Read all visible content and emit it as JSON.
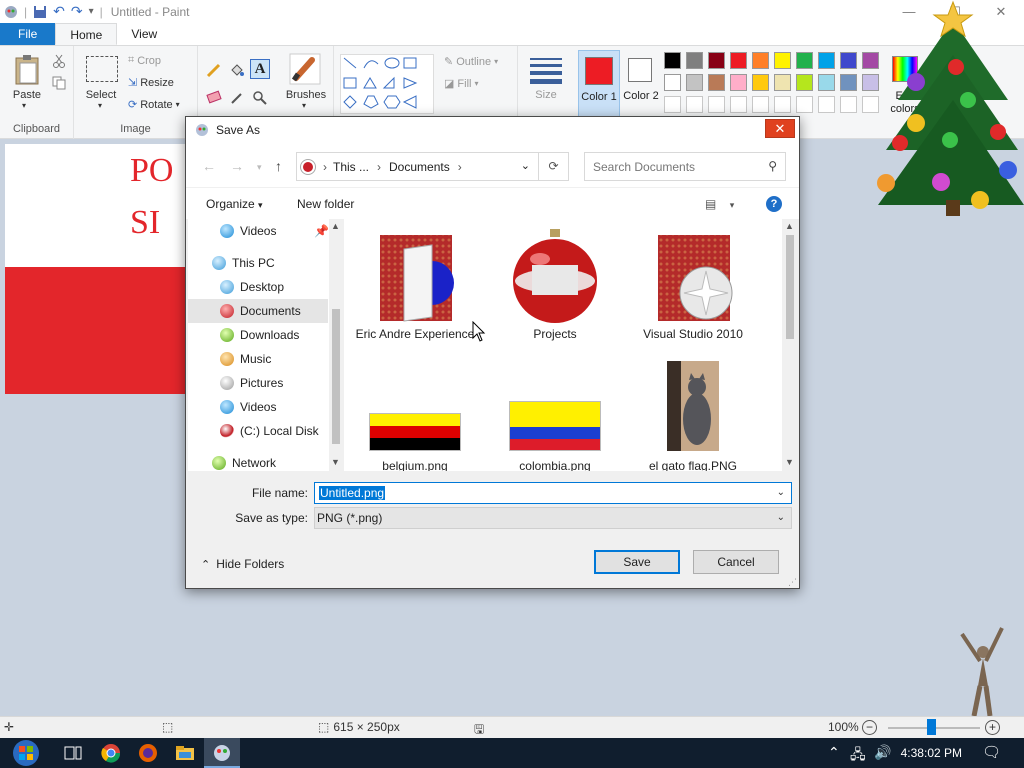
{
  "paint": {
    "title": "Untitled - Paint",
    "tabs": [
      "File",
      "Home",
      "View"
    ],
    "ribbon": {
      "clipboard": {
        "label": "Clipboard",
        "paste": "Paste"
      },
      "image": {
        "label": "Image",
        "select": "Select",
        "crop": "Crop",
        "resize": "Resize",
        "rotate": "Rotate"
      },
      "tools": {
        "brushes": "Brushes"
      },
      "shapes": {
        "outline": "Outline",
        "fill": "Fill"
      },
      "size": "Size",
      "color1": "Color 1",
      "color2": "Color 2",
      "edit_colors": "Edit colors"
    },
    "palette_row1": [
      "#000000",
      "#7f7f7f",
      "#880015",
      "#ed1c24",
      "#ff7f27",
      "#fff200",
      "#22b14c",
      "#00a2e8",
      "#3f48cc",
      "#a349a4"
    ],
    "palette_row2": [
      "#ffffff",
      "#c3c3c3",
      "#b97a57",
      "#ffaec9",
      "#ffc90e",
      "#efe4b0",
      "#b5e61d",
      "#99d9ea",
      "#7092be",
      "#c8bfe7"
    ],
    "canvas_text": [
      "PO",
      "SI"
    ],
    "status": {
      "dimensions": "615 × 250px",
      "zoom": "100%"
    }
  },
  "dialog": {
    "title": "Save As",
    "close": "✕",
    "breadcrumb": [
      "This ...",
      "Documents"
    ],
    "search_placeholder": "Search Documents",
    "organize": "Organize",
    "new_folder": "New folder",
    "nav": {
      "videos_top": "Videos",
      "this_pc": "This PC",
      "desktop": "Desktop",
      "documents": "Documents",
      "downloads": "Downloads",
      "music": "Music",
      "pictures": "Pictures",
      "videos": "Videos",
      "local_disk": "(C:) Local Disk",
      "network": "Network"
    },
    "files": {
      "f1": "Eric Andre Experience",
      "f2": "Projects",
      "f3": "Visual Studio 2010",
      "f4": "belgium.png",
      "f5": "colombia.png",
      "f6": "el gato flag.PNG"
    },
    "file_name_label": "File name:",
    "file_name_value": "Untitled.png",
    "save_type_label": "Save as type:",
    "save_type_value": "PNG (*.png)",
    "save": "Save",
    "cancel": "Cancel",
    "hide_folders": "Hide Folders"
  },
  "taskbar": {
    "time": "4:38:02 PM"
  }
}
